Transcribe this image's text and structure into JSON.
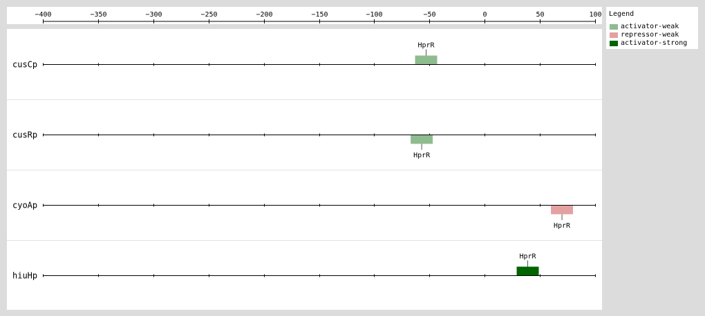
{
  "axis": {
    "min": -400,
    "max": 100,
    "ticks": [
      -400,
      -350,
      -300,
      -250,
      -200,
      -150,
      -100,
      -50,
      0,
      50,
      100
    ],
    "tick_labels": [
      "−400",
      "−350",
      "−300",
      "−250",
      "−200",
      "−150",
      "−100",
      "−50",
      "0",
      "50",
      "100"
    ]
  },
  "legend": {
    "title": "Legend",
    "items": [
      {
        "label": "activator-weak",
        "color": "#8fbc8f"
      },
      {
        "label": "repressor-weak",
        "color": "#e4a1a1"
      },
      {
        "label": "activator-strong",
        "color": "#006400"
      }
    ]
  },
  "tracks": [
    {
      "name": "cusCp",
      "sites": [
        {
          "label": "HprR",
          "start": -63,
          "end": -43,
          "type": "activator-weak",
          "strand": "up"
        }
      ]
    },
    {
      "name": "cusRp",
      "sites": [
        {
          "label": "HprR",
          "start": -67,
          "end": -47,
          "type": "activator-weak",
          "strand": "down"
        }
      ]
    },
    {
      "name": "cyoAp",
      "sites": [
        {
          "label": "HprR",
          "start": 60,
          "end": 80,
          "type": "repressor-weak",
          "strand": "down"
        }
      ]
    },
    {
      "name": "hiuHp",
      "sites": [
        {
          "label": "HprR",
          "start": 29,
          "end": 49,
          "type": "activator-strong",
          "strand": "up"
        }
      ]
    }
  ]
}
